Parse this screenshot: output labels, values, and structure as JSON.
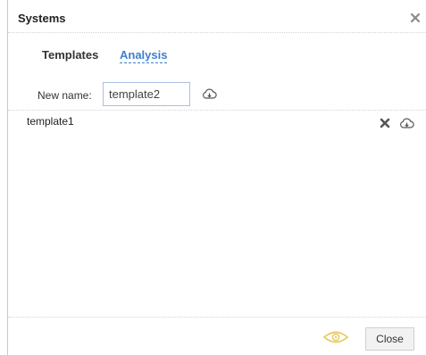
{
  "dialog": {
    "title": "Systems"
  },
  "tabs": [
    {
      "label": "Templates",
      "active": false
    },
    {
      "label": "Analysis",
      "active": true
    }
  ],
  "form": {
    "new_name_label": "New name:",
    "new_name_value": "template2"
  },
  "templates": [
    {
      "name": "template1"
    }
  ],
  "footer": {
    "close_label": "Close"
  },
  "icons": {
    "dialog_close": "close-icon",
    "save": "cloud-download-icon",
    "delete": "delete-icon",
    "download": "cloud-download-icon",
    "preview": "eye-icon"
  },
  "colors": {
    "accent": "#3d7fd0",
    "eye": "#e8c85a"
  }
}
